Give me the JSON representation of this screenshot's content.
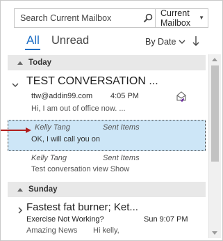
{
  "search": {
    "placeholder": "Search Current Mailbox",
    "scope": "Current Mailbox"
  },
  "filters": {
    "all": "All",
    "unread": "Unread",
    "sort": "By Date"
  },
  "groups": {
    "today": "Today",
    "sunday": "Sunday"
  },
  "conversation": {
    "title": "TEST CONVERSATION ...",
    "messages": [
      {
        "sender": "ttw@addin99.com",
        "time": "4:05 PM",
        "preview": "Hi,  I am out of office now. ..."
      },
      {
        "sender": "Kelly Tang",
        "folder": "Sent Items",
        "preview": "OK, I will call you on"
      },
      {
        "sender": "Kelly Tang",
        "folder": "Sent Items",
        "preview": "Test conversation view  Show"
      }
    ]
  },
  "sunday_item": {
    "title": "Fastest fat burner;  Ket...",
    "subject": "Exercise Not Working?",
    "time": "Sun 9:07 PM",
    "sender": "Amazing News",
    "preview": "Hi kelly,"
  },
  "colors": {
    "accent": "#1f6fc5",
    "selected_bg": "#cde6f7",
    "arrow": "#b01e1e"
  }
}
